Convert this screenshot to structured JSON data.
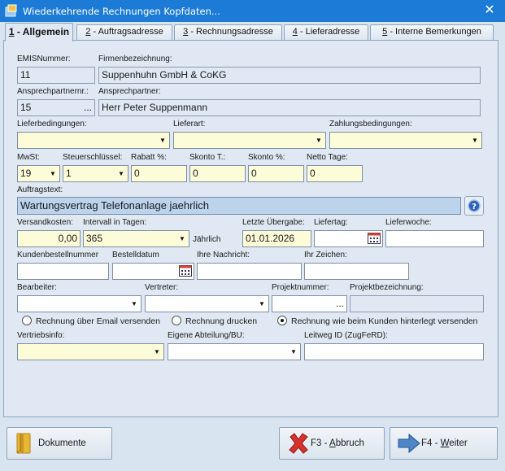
{
  "window": {
    "title": "Wiederkehrende Rechnungen Kopfdaten..."
  },
  "tabs": [
    {
      "num": "1",
      "label": " - Allgemein"
    },
    {
      "num": "2",
      "label": " - Auftragsadresse"
    },
    {
      "num": "3",
      "label": " - Rechnungsadresse"
    },
    {
      "num": "4",
      "label": " - Lieferadresse"
    },
    {
      "num": "5",
      "label": " - Interne Bemerkungen"
    }
  ],
  "form": {
    "emis_label": "EMISNummer:",
    "emis_value": "11",
    "firma_label": "Firmenbezeichnung:",
    "firma_value": "Suppenhuhn GmbH & CoKG",
    "ansp_nr_label": "Ansprechpartnernr.:",
    "ansp_nr_value": "15",
    "ansp_label": "Ansprechpartner:",
    "ansp_value": "Herr Peter Suppenmann",
    "lieferbed_label": "Lieferbedingungen:",
    "lieferart_label": "Lieferart:",
    "zahlung_label": "Zahlungsbedingungen:",
    "mwst_label": "MwSt:",
    "mwst_value": "19",
    "steuer_label": "Steuerschlüssel:",
    "steuer_value": "1",
    "rabatt_label": "Rabatt %:",
    "rabatt_value": "0",
    "skonto_t_label": "Skonto T.:",
    "skonto_t_value": "0",
    "skonto_p_label": "Skonto %:",
    "skonto_p_value": "0",
    "netto_label": "Netto Tage:",
    "netto_value": "0",
    "auftragstext_label": "Auftragstext:",
    "auftragstext_value": "Wartungsvertrag Telefonanlage jaehrlich",
    "versand_label": "Versandkosten:",
    "versand_value": "0,00",
    "intervall_label": "Intervall in Tagen:",
    "intervall_value": "365",
    "jaehrlich_label": "Jährlich",
    "letzte_label": "Letzte Übergabe:",
    "letzte_value": "01.01.2026",
    "liefertag_label": "Liefertag:",
    "lieferwoche_label": "Lieferwoche:",
    "kundenbest_label": "Kundenbestellnummer",
    "bestelldatum_label": "Bestelldatum",
    "ihre_nachricht_label": "Ihre Nachricht:",
    "ihr_zeichen_label": "Ihr Zeichen:",
    "bearbeiter_label": "Bearbeiter:",
    "vertreter_label": "Vertreter:",
    "projektnr_label": "Projektnummer:",
    "projektbez_label": "Projektbezeichnung:",
    "radio_email": "Rechnung über Email versenden",
    "radio_drucken": "Rechnung drucken",
    "radio_kunde": "Rechnung wie beim Kunden hinterlegt versenden",
    "vertriebsinfo_label": "Vertriebsinfo:",
    "abteilung_label": "Eigene Abteilung/BU:",
    "leitweg_label": "Leitweg ID (ZugFeRD):"
  },
  "buttons": {
    "dokumente": "Dokumente",
    "abbruch_key": "F3 - ",
    "abbruch_u": "A",
    "abbruch_rest": "bbruch",
    "weiter_key": "F4 - ",
    "weiter_u": "W",
    "weiter_rest": "eiter"
  },
  "colors": {
    "titlebar": "#1b7bd6",
    "window_bg": "#dfe8f3",
    "yellow_field": "#fdfcd8",
    "highlight_field": "#bcd3ee"
  }
}
